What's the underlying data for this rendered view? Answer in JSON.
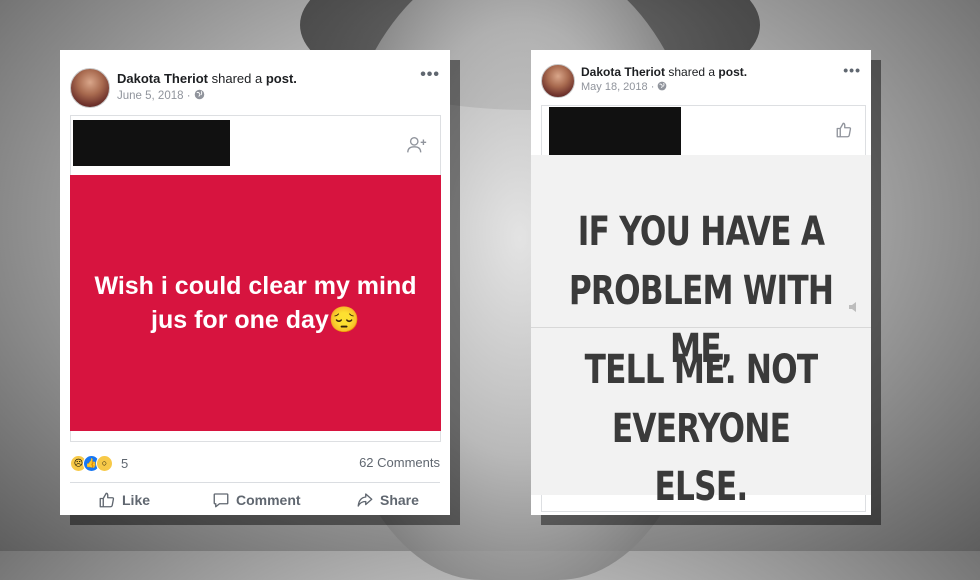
{
  "left_post": {
    "author": "Dakota Theriot",
    "shared_text": "shared a",
    "post_word": "post.",
    "date": "June 5, 2018 · ",
    "globe_icon": "globe-icon",
    "more_glyph": "•••",
    "post_text": "Wish i could clear my mind jus for one day😔",
    "post_bg_color": "#d7143f",
    "reaction_count": "5",
    "comments_label": "62 Comments",
    "actions": {
      "like": "Like",
      "comment": "Comment",
      "share": "Share"
    }
  },
  "right_post": {
    "author": "Dakota Theriot",
    "shared_text": "shared a",
    "post_word": "post.",
    "date": "May 18, 2018 · ",
    "more_glyph": "•••",
    "meme_lines": [
      "IF YOU HAVE A",
      "PROBLEM WITH ME,",
      "TELL ME. NOT",
      "EVERYONE ELSE."
    ]
  }
}
